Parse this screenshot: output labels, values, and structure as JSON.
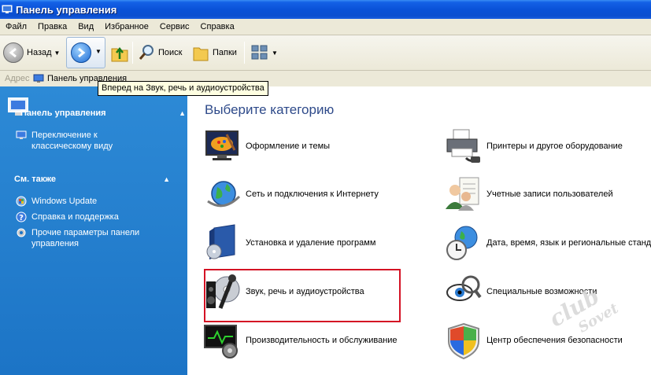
{
  "window": {
    "title": "Панель управления"
  },
  "menu": [
    "Файл",
    "Правка",
    "Вид",
    "Избранное",
    "Сервис",
    "Справка"
  ],
  "toolbar": {
    "back": "Назад",
    "search": "Поиск",
    "folders": "Папки"
  },
  "address": {
    "label": "Адрес",
    "value": "Панель управления"
  },
  "tooltip": "Вперед на Звук, речь и аудиоустройства",
  "sidebar": {
    "panel_title": "Панель управления",
    "switch_view": "Переключение к классическому виду",
    "see_also_title": "См. также",
    "see_also": [
      "Windows Update",
      "Справка и поддержка",
      "Прочие параметры панели управления"
    ]
  },
  "main": {
    "heading": "Выберите категорию",
    "categories": [
      "Оформление и темы",
      "Сеть и подключения к Интернету",
      "Установка и удаление программ",
      "Звук, речь и аудиоустройства",
      "Производительность и обслуживание",
      "Принтеры и другое оборудование",
      "Учетные записи пользователей",
      "Дата, время, язык и региональные стандарты",
      "Специальные возможности",
      "Центр обеспечения безопасности"
    ]
  },
  "watermark": {
    "line1": "club",
    "line2": "Sovet"
  },
  "colors": {
    "highlight": "#d41224",
    "sidebar": "#1c74c6",
    "heading": "#2e4a8a"
  }
}
